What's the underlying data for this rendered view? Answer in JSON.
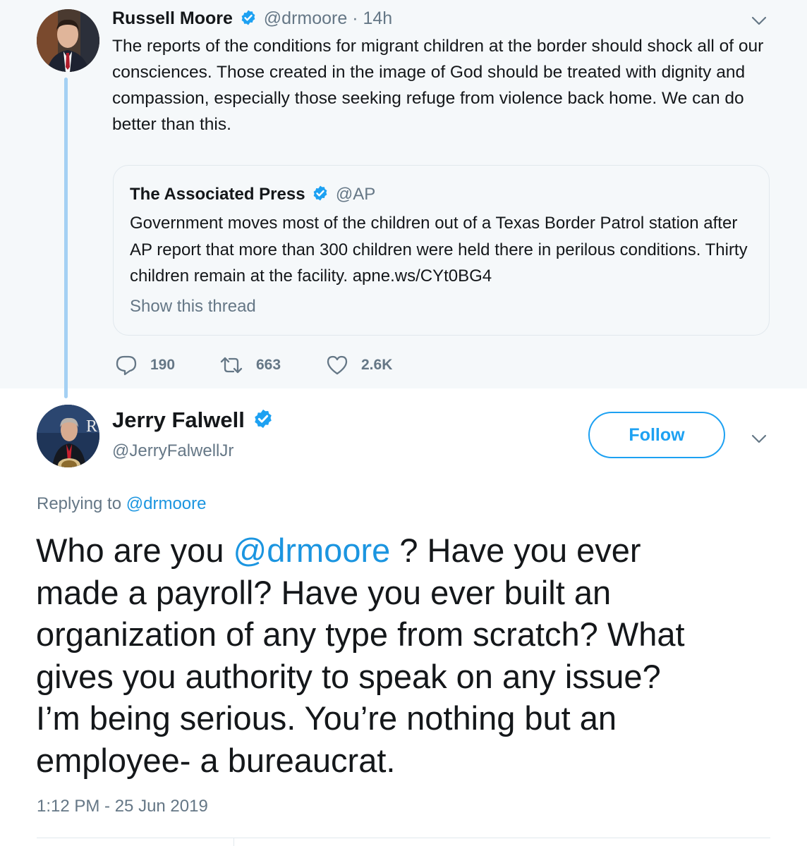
{
  "colors": {
    "accent": "#1da1f2",
    "link": "#1b95e0",
    "secondary_text": "#657786",
    "primary_text": "#14171a",
    "parent_background": "#f5f8fa",
    "thread_line": "#a4d0f3"
  },
  "parent_tweet": {
    "author_name": "Russell Moore",
    "author_handle": "@drmoore",
    "time_ago": "· 14h",
    "text": "The reports of the conditions for migrant children at the border should shock all of our consciences. Those created in the image of God should be treated with dignity and compassion, especially those seeking refuge from violence back home. We can do better than this.",
    "icons": [
      "verified-badge-icon",
      "chevron-down-icon"
    ],
    "quoted_tweet": {
      "author_name": "The Associated Press",
      "author_handle": "@AP",
      "text": "Government moves most of the children out of a Texas Border Patrol station after AP report that more than 300 children were held there in perilous conditions. Thirty children remain at the facility. apne.ws/CYt0BG4",
      "show_thread": "Show this thread"
    },
    "actions": {
      "replies": "190",
      "retweets": "663",
      "likes": "2.6K",
      "icons": [
        "reply-icon",
        "retweet-icon",
        "like-icon"
      ]
    }
  },
  "main_tweet": {
    "author_name": "Jerry Falwell",
    "author_handle": "@JerryFalwellJr",
    "follow_label": "Follow",
    "replying_prefix": "Replying to",
    "replying_to": "@drmoore",
    "text_before_mention": "Who are you ",
    "mention": "@drmoore",
    "text_after_mention": " ?  Have you ever\nmade a payroll?  Have you ever built an\norganization of any type from scratch?  What\ngives you authority to speak on any issue?\nI’m being serious.  You’re nothing but an\nemployee- a bureaucrat.",
    "timestamp": "1:12 PM - 25 Jun 2019",
    "icons": [
      "verified-badge-icon",
      "chevron-down-icon"
    ]
  }
}
